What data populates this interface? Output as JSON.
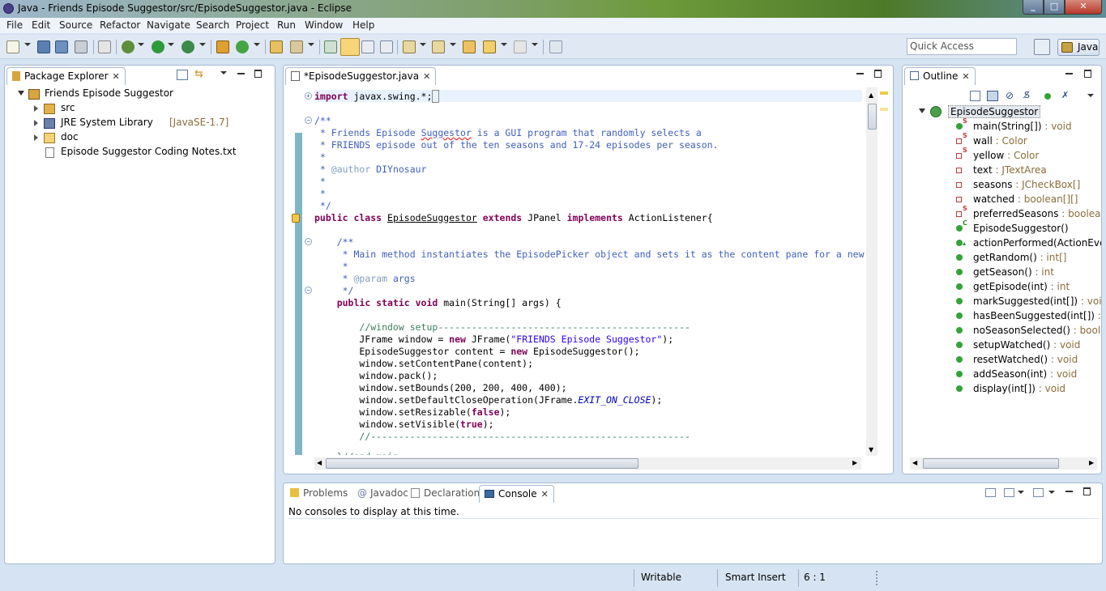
{
  "window": {
    "title": "Java - Friends Episode Suggestor/src/EpisodeSuggestor.java - Eclipse"
  },
  "menu": [
    "File",
    "Edit",
    "Source",
    "Refactor",
    "Navigate",
    "Search",
    "Project",
    "Run",
    "Window",
    "Help"
  ],
  "toolbar": {
    "quick_access_placeholder": "Quick Access",
    "perspective": "Java"
  },
  "package_explorer": {
    "title": "Package Explorer",
    "project": "Friends Episode Suggestor",
    "items": [
      {
        "label": "src",
        "extra": ""
      },
      {
        "label": "JRE System Library",
        "extra": "[JavaSE-1.7]"
      },
      {
        "label": "doc",
        "extra": ""
      },
      {
        "label": "Episode Suggestor Coding Notes.txt",
        "extra": ""
      }
    ]
  },
  "editor": {
    "tab": "*EpisodeSuggestor.java"
  },
  "outline": {
    "title": "Outline",
    "class": "EpisodeSuggestor",
    "members": [
      {
        "name": "main(String[])",
        "type": " : void"
      },
      {
        "name": "wall",
        "type": " : Color"
      },
      {
        "name": "yellow",
        "type": " : Color"
      },
      {
        "name": "text",
        "type": " : JTextArea"
      },
      {
        "name": "seasons",
        "type": " : JCheckBox[]"
      },
      {
        "name": "watched",
        "type": " : boolean[][]"
      },
      {
        "name": "preferredSeasons",
        "type": " : boolean[]"
      },
      {
        "name": "EpisodeSuggestor()",
        "type": ""
      },
      {
        "name": "actionPerformed(ActionEvent",
        "type": ""
      },
      {
        "name": "getRandom()",
        "type": " : int[]"
      },
      {
        "name": "getSeason()",
        "type": " : int"
      },
      {
        "name": "getEpisode(int)",
        "type": " : int"
      },
      {
        "name": "markSuggested(int[])",
        "type": " : void"
      },
      {
        "name": "hasBeenSuggested(int[])",
        "type": " : boo"
      },
      {
        "name": "noSeasonSelected()",
        "type": " : boolean"
      },
      {
        "name": "setupWatched()",
        "type": " : void"
      },
      {
        "name": "resetWatched()",
        "type": " : void"
      },
      {
        "name": "addSeason(int)",
        "type": " : void"
      },
      {
        "name": "display(int[])",
        "type": " : void"
      }
    ]
  },
  "bottom": {
    "tabs": [
      "Problems",
      "Javadoc",
      "Declaration",
      "Console"
    ],
    "message": "No consoles to display at this time."
  },
  "status": {
    "writable": "Writable",
    "insert": "Smart Insert",
    "position": "6 : 1"
  }
}
